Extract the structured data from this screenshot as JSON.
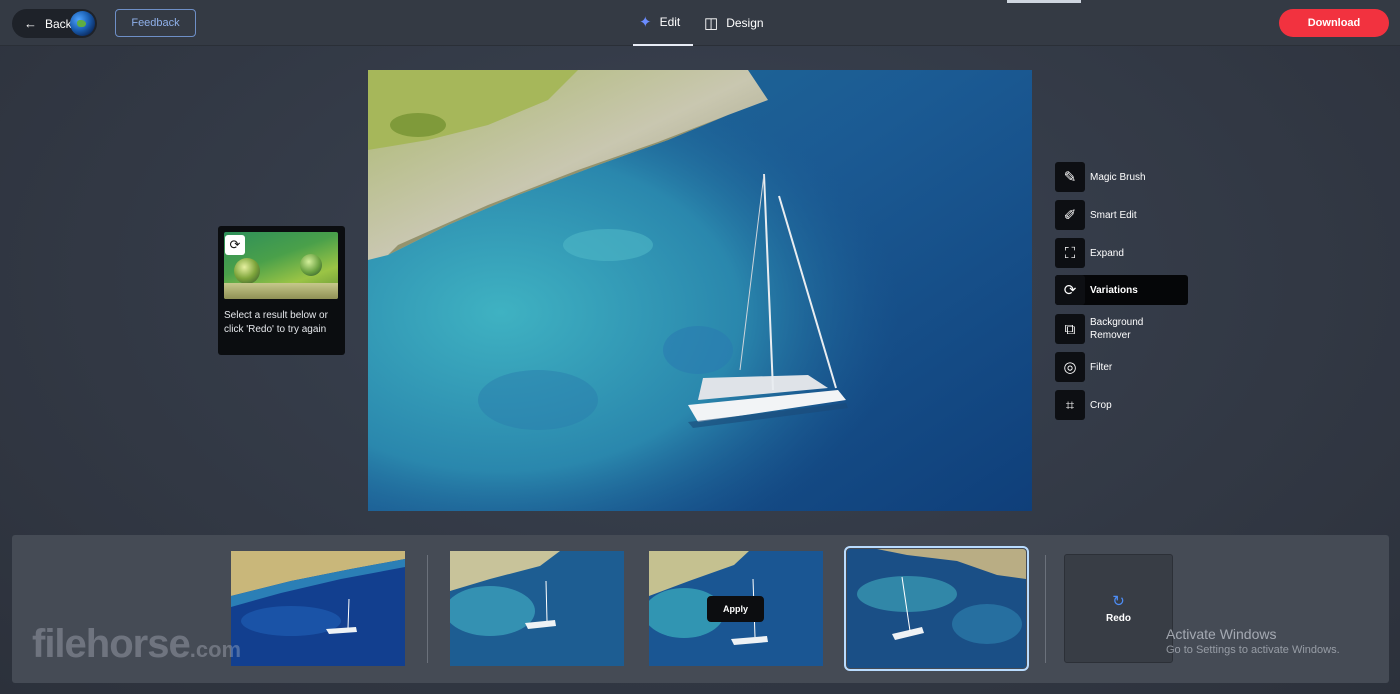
{
  "header": {
    "back_label": "Back",
    "feedback_label": "Feedback",
    "tabs": [
      {
        "label": "Edit",
        "icon": "sparkle-icon",
        "active": true
      },
      {
        "label": "Design",
        "icon": "layout-icon",
        "active": false
      }
    ],
    "download_label": "Download",
    "accent_color": "#f2323f"
  },
  "variation_panel": {
    "note": "Select a result below or click 'Redo' to try again"
  },
  "tools": [
    {
      "label": "Magic Brush",
      "icon": "magic-brush-icon"
    },
    {
      "label": "Smart Edit",
      "icon": "smart-edit-icon"
    },
    {
      "label": "Expand",
      "icon": "expand-icon"
    },
    {
      "label": "Variations",
      "icon": "variations-icon",
      "active": true
    },
    {
      "label": "Background Remover",
      "icon": "background-remover-icon"
    },
    {
      "label": "Filter",
      "icon": "filter-icon"
    },
    {
      "label": "Crop",
      "icon": "crop-icon"
    }
  ],
  "results": {
    "apply_label": "Apply",
    "redo_label": "Redo",
    "selected_index": 3
  },
  "overlays": {
    "watermark": "filehorse",
    "watermark_suffix": ".com",
    "activate_title": "Activate Windows",
    "activate_sub": "Go to Settings to activate Windows."
  }
}
